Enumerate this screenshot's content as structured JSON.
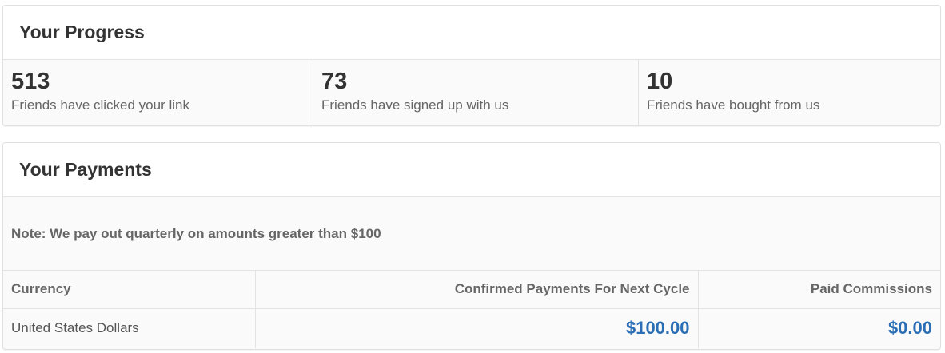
{
  "progress": {
    "title": "Your Progress",
    "stats": [
      {
        "number": "513",
        "label": "Friends have clicked your link"
      },
      {
        "number": "73",
        "label": "Friends have signed up with us"
      },
      {
        "number": "10",
        "label": "Friends have bought from us"
      }
    ]
  },
  "payments": {
    "title": "Your Payments",
    "note": "Note: We pay out quarterly on amounts greater than $100",
    "columns": [
      "Currency",
      "Confirmed Payments For Next Cycle",
      "Paid Commissions"
    ],
    "rows": [
      {
        "currency": "United States Dollars",
        "confirmed": "$100.00",
        "paid": "$0.00"
      }
    ]
  },
  "colors": {
    "amount": "#2a6eb5",
    "label": "#666666",
    "border": "#e3e3e3"
  }
}
